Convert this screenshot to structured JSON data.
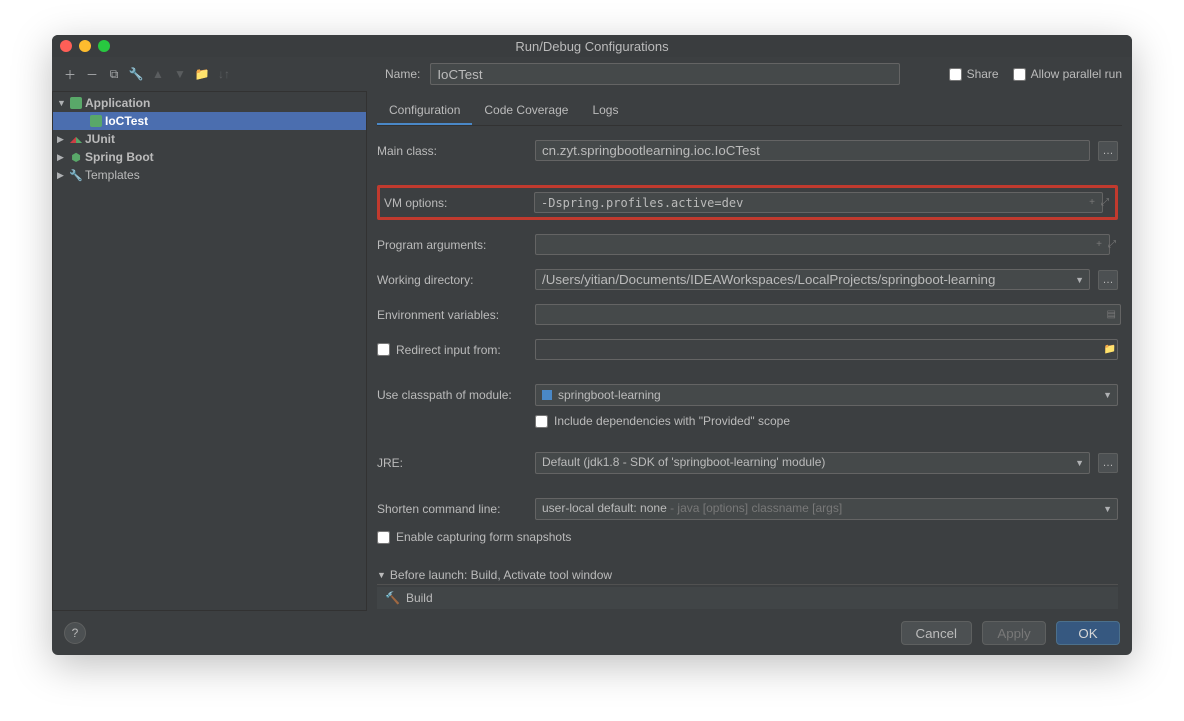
{
  "window": {
    "title": "Run/Debug Configurations"
  },
  "name_field": {
    "label": "Name:",
    "value": "IoCTest"
  },
  "checkboxes": {
    "share": "Share",
    "parallel": "Allow parallel run"
  },
  "tree": {
    "nodes": [
      {
        "label": "Application",
        "icon": "app",
        "expanded": true,
        "bold": true,
        "indent": 0
      },
      {
        "label": "IoCTest",
        "icon": "app",
        "selected": true,
        "bold": true,
        "indent": 1
      },
      {
        "label": "JUnit",
        "icon": "junit",
        "bold": true,
        "indent": 0,
        "leaf": false
      },
      {
        "label": "Spring Boot",
        "icon": "spring",
        "bold": true,
        "indent": 0,
        "leaf": false
      },
      {
        "label": "Templates",
        "icon": "wrench",
        "indent": 0,
        "leaf": false
      }
    ]
  },
  "tabs": [
    {
      "label": "Configuration",
      "active": true
    },
    {
      "label": "Code Coverage"
    },
    {
      "label": "Logs"
    }
  ],
  "form": {
    "main_class": {
      "label": "Main class:",
      "value": "cn.zyt.springbootlearning.ioc.IoCTest"
    },
    "vm_options": {
      "label": "VM options:",
      "value": "-Dspring.profiles.active=dev"
    },
    "program_args": {
      "label": "Program arguments:",
      "value": ""
    },
    "working_dir": {
      "label": "Working directory:",
      "value": "/Users/yitian/Documents/IDEAWorkspaces/LocalProjects/springboot-learning"
    },
    "env_vars": {
      "label": "Environment variables:",
      "value": ""
    },
    "redirect": {
      "label": "Redirect input from:",
      "value": ""
    },
    "classpath": {
      "label": "Use classpath of module:",
      "value": "springboot-learning"
    },
    "include_provided": "Include dependencies with \"Provided\" scope",
    "jre": {
      "label": "JRE:",
      "value": "Default (jdk1.8 - SDK of 'springboot-learning' module)"
    },
    "shorten": {
      "label": "Shorten command line:",
      "value": "user-local default: none",
      "suffix": " - java [options] classname [args]"
    },
    "snapshots": "Enable capturing form snapshots"
  },
  "before_launch": {
    "header": "Before launch: Build, Activate tool window",
    "item": "Build"
  },
  "buttons": {
    "cancel": "Cancel",
    "apply": "Apply",
    "ok": "OK"
  }
}
